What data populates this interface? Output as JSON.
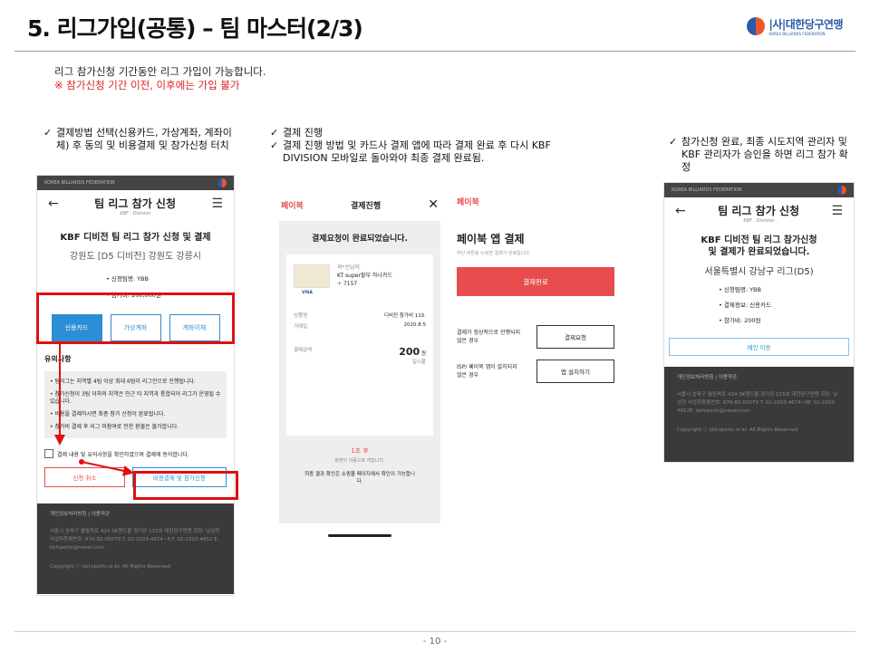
{
  "page": {
    "title": "5. 리그가입(공통) – 팀 마스터(2/3)",
    "logo_ko": "|사|대한당구연맹",
    "logo_en": "KOREA BILLIARDS FEDERATION",
    "page_number": "- 10 -"
  },
  "intro": {
    "line1": "리그 참가신청 기간동안 리그 가입이 가능합니다.",
    "line2": "※ 참가신청 기간 이전, 이후에는 가입 불가"
  },
  "col1": {
    "bullet": "결제방법 선택(신용카드, 가상계좌, 계좌이체) 후 동의 및 비용결제 및 참가신청 터치"
  },
  "col2": {
    "bullet1": "결제 진행",
    "bullet2": "결제 진행 방법 및 카드사 결제 앱에 따라 결제 완료 후 다시 KBF DIVISION 모바일로 돌아와야 최종 결제 완료됨."
  },
  "col3": {
    "bullet": "참가신청 완료, 최종 시도지역 관리자 및 KBF 관리자가 승인을 하면 리그 참가 확정"
  },
  "screen1": {
    "topbar": "KOREA BILLIARDS FEDERATION",
    "nav_title": "팀 리그 참가 신청",
    "nav_sub": "KBF · Division",
    "heading": "KBF 디비전 팀 리그 참가 신청 및 결제",
    "region": "강원도 [D5 디비전] 강원도 강릉시",
    "team": "신청팀명: YBB",
    "fee": "참가비: 200,000원",
    "pay_methods": [
      "신용카드",
      "가상계좌",
      "계좌이체"
    ],
    "notice_title": "유의사항",
    "notices": [
      "팀리그는 지역별 4팀 이상 최대 6팀이 리그전으로 진행됩니다.",
      "참가신청이 3팀 이하의 지역은 인근 타 지역과 통합되어 리그가 운영될 수 있습니다.",
      "비용을 결제하시면 최종 참가 신청이 완료됩니다.",
      "참가비 결제 후 리그 미참여로 인한 환불은 불가합니다."
    ],
    "agree": "결제 내용 및 유의사항을 확인하였으며 결제에 동의합니다.",
    "cancel_btn": "신청 취소",
    "submit_btn": "비용결제 및 참가신청",
    "footer_links": "개인정보처리방침  |  이용약관",
    "footer_addr": "서울시 송파구 올림픽로 424 SK핸드볼 경기장 115호 대한당구연맹 회장: 남삼현 사업자등록번호: 676-82-00079 T. 02-2203-4674~6 F. 02-2203-4652 E. kbfsports@naver.com",
    "footer_copy": "Copyright ⓒ kbf.sports.or.kr. All Rights Reserved"
  },
  "screen2": {
    "brand": "페이북",
    "header": "결제진행",
    "close": "✕",
    "done_msg": "결제요청이 완료되었습니다.",
    "card_owner": "곽*선님의",
    "card_name": "KT super할부 하나카드",
    "card_num": "7157",
    "visa": "VISA",
    "product_label": "상품명",
    "product_value": "디비전 참가비 110.",
    "date_label": "거래일",
    "date_value": "2020.8.5",
    "amount_label": "결제금액",
    "amount_value": "200",
    "amount_unit": "원",
    "installment": "일시불",
    "countdown": "1초 후",
    "countdown_sub": "화면이 자동으로 꺼집니다.",
    "final_msg": "최종 결과 확인은 쇼핑몰 페이지에서 확인이 가능합니다."
  },
  "screen3": {
    "brand": "페이북",
    "title": "페이북 앱 결제",
    "sub": "하단 버튼을 누르면 결제가 완료됩니다.",
    "confirm_btn": "결제완료",
    "row1_label": "결제가 정상적으로 진행되지 않은 경우",
    "row1_btn": "결제요청",
    "row2_label": "ISP/ 페이북 앱이 설치되지 않은 경우",
    "row2_btn": "앱 설치하기"
  },
  "screen4": {
    "topbar": "KOREA BILLIARDS FEDERATION",
    "nav_title": "팀 리그 참가 신청",
    "nav_sub": "KBF · Division",
    "heading1": "KBF 디비전 팀 리그 참가신청",
    "heading2": "및 결제가 완료되었습니다.",
    "region": "서울특별시 강남구 리그(D5)",
    "team": "신청팀명: YBB",
    "pay": "결제정보: 신용카드",
    "fee": "참가비: 200원",
    "main_btn": "메인 이동",
    "footer_links": "개인정보처리방침  |  이용약관",
    "footer_addr": "서울시 송파구 올림픽로 424 SK핸드볼 경기장 115호 대한당구연맹 회장: 남삼현 사업자등록번호: 676-82-00079 T. 02-2203-4674~6F. 02-2203-4652E. kbfsports@naver.com",
    "footer_copy": "Copyright ⓒ kbf.sports.or.kr. All Rights Reserved"
  }
}
